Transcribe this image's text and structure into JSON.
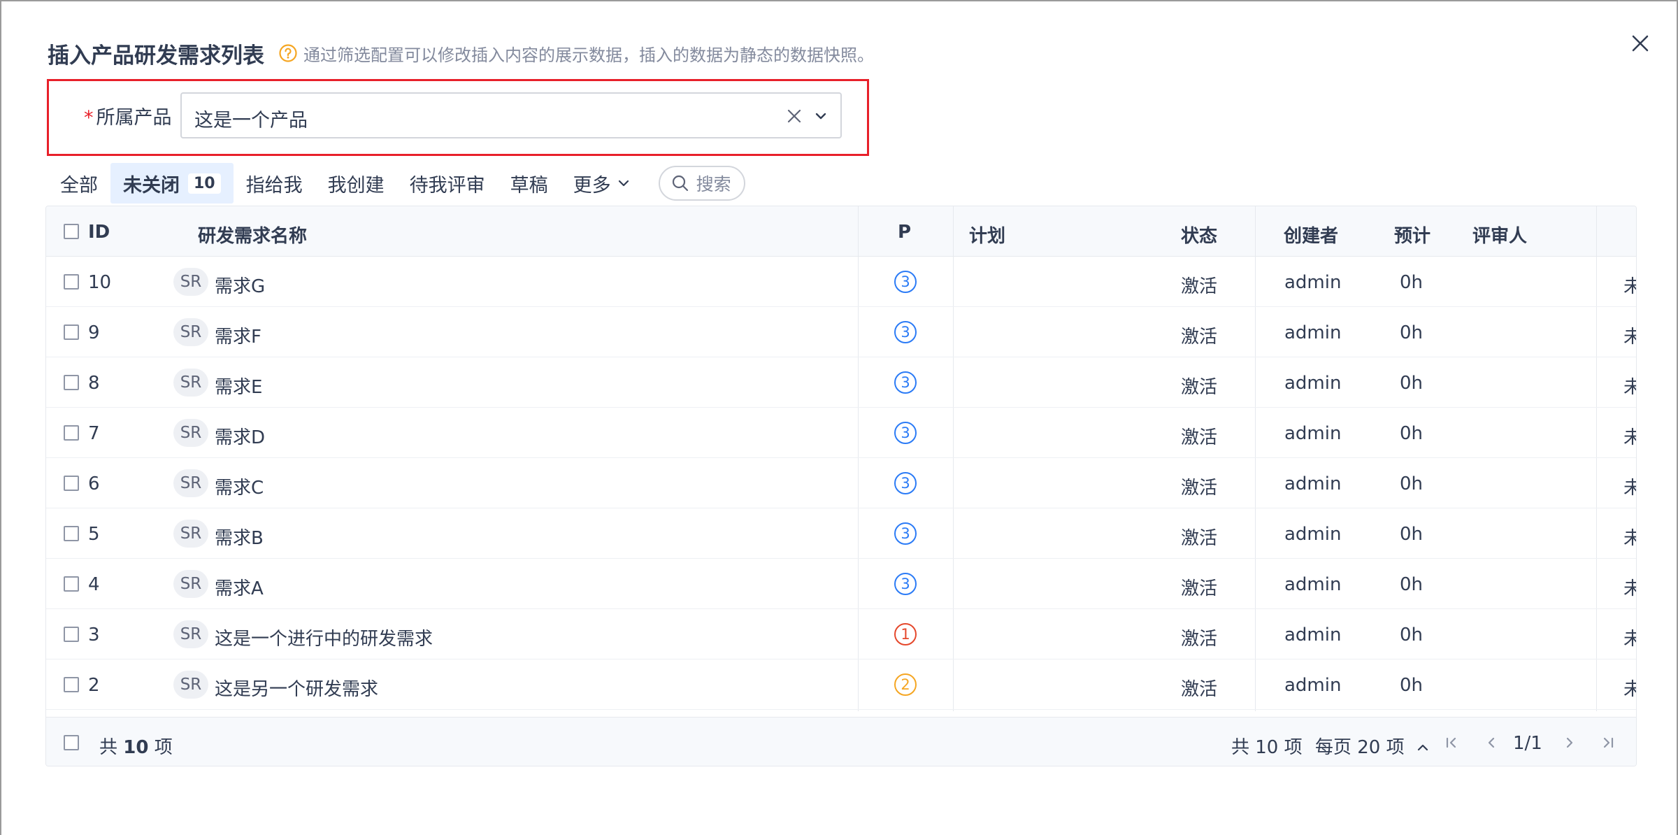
{
  "dialog": {
    "title": "插入产品研发需求列表",
    "subtitle": "通过筛选配置可以修改插入内容的展示数据，插入的数据为静态的数据快照。"
  },
  "product_field": {
    "required_mark": "*",
    "label": "所属产品",
    "value": "这是一个产品"
  },
  "tabs": [
    {
      "label": "全部"
    },
    {
      "label": "未关闭",
      "count": "10"
    },
    {
      "label": "指给我"
    },
    {
      "label": "我创建"
    },
    {
      "label": "待我评审"
    },
    {
      "label": "草稿"
    },
    {
      "label": "更多"
    }
  ],
  "search": {
    "label": "搜索"
  },
  "table": {
    "columns": [
      "ID",
      "研发需求名称",
      "P",
      "计划",
      "状态",
      "创建者",
      "预计",
      "评审人"
    ],
    "rows": [
      {
        "id": "10",
        "type": "SR",
        "name": "需求G",
        "pri": "3",
        "plan": "",
        "status": "激活",
        "creator": "admin",
        "estimate": "0h",
        "reviewer": "",
        "extra": "未"
      },
      {
        "id": "9",
        "type": "SR",
        "name": "需求F",
        "pri": "3",
        "plan": "",
        "status": "激活",
        "creator": "admin",
        "estimate": "0h",
        "reviewer": "",
        "extra": "未"
      },
      {
        "id": "8",
        "type": "SR",
        "name": "需求E",
        "pri": "3",
        "plan": "",
        "status": "激活",
        "creator": "admin",
        "estimate": "0h",
        "reviewer": "",
        "extra": "未"
      },
      {
        "id": "7",
        "type": "SR",
        "name": "需求D",
        "pri": "3",
        "plan": "",
        "status": "激活",
        "creator": "admin",
        "estimate": "0h",
        "reviewer": "",
        "extra": "未"
      },
      {
        "id": "6",
        "type": "SR",
        "name": "需求C",
        "pri": "3",
        "plan": "",
        "status": "激活",
        "creator": "admin",
        "estimate": "0h",
        "reviewer": "",
        "extra": "未"
      },
      {
        "id": "5",
        "type": "SR",
        "name": "需求B",
        "pri": "3",
        "plan": "",
        "status": "激活",
        "creator": "admin",
        "estimate": "0h",
        "reviewer": "",
        "extra": "未"
      },
      {
        "id": "4",
        "type": "SR",
        "name": "需求A",
        "pri": "3",
        "plan": "",
        "status": "激活",
        "creator": "admin",
        "estimate": "0h",
        "reviewer": "",
        "extra": "未"
      },
      {
        "id": "3",
        "type": "SR",
        "name": "这是一个进行中的研发需求",
        "pri": "1",
        "plan": "",
        "status": "激活",
        "creator": "admin",
        "estimate": "0h",
        "reviewer": "",
        "extra": "未"
      },
      {
        "id": "2",
        "type": "SR",
        "name": "这是另一个研发需求",
        "pri": "2",
        "plan": "",
        "status": "激活",
        "creator": "admin",
        "estimate": "0h",
        "reviewer": "",
        "extra": "未"
      }
    ]
  },
  "footer": {
    "select_total_prefix": "共",
    "select_total_count": "10",
    "select_total_suffix": "项",
    "total_text": "共 10 项",
    "per_page_text": "每页 20 项",
    "page_text": "1/1"
  },
  "colors": {
    "accent": "#2b7bf6",
    "required": "#e8202a",
    "priority": {
      "1": "#e5482c",
      "2": "#f5a623",
      "3": "#2b7bf6"
    },
    "help_icon": "#f5a623",
    "active_tab_bg": "#e6f0ff"
  },
  "icons": {
    "close": "close-icon",
    "help": "question-circle-icon",
    "clear": "clear-icon",
    "caret": "chevron-down-icon",
    "search": "search-icon",
    "first_page": "first-page-icon",
    "prev_page": "prev-page-icon",
    "next_page": "next-page-icon",
    "last_page": "last-page-icon"
  }
}
